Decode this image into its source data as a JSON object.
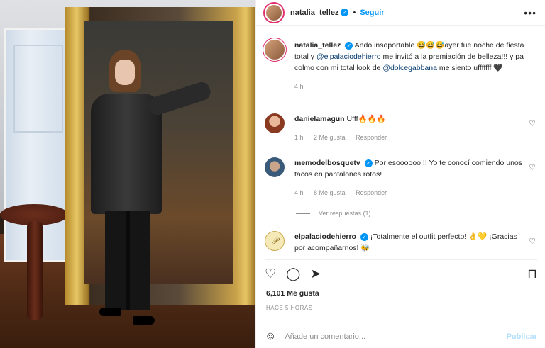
{
  "post": {
    "username": "natalia_tellez",
    "follow_label": "Seguir",
    "more_icon": "more-horizontal-icon",
    "caption": {
      "user": "natalia_tellez",
      "text_1": "Ando insoportable 😅😅😅ayer fue noche de fiesta total y ",
      "mention_1": "@elpalaciodehierro",
      "text_2": " me invitó a la premiación de belleza!!! y pa colmo con mi total look de ",
      "mention_2": "@dolcegabbana",
      "text_3": " me siento ufffffff 🖤",
      "time": "4 h"
    },
    "comments": [
      {
        "user": "danielamagun",
        "text": "Ufff🔥🔥🔥",
        "time": "1 h",
        "likes": "2 Me gusta",
        "reply": "Responder"
      },
      {
        "user": "memodelbosquetv",
        "text": "Por esoooooo!!! Yo te conocí comiendo unos tacos en pantalones rotos!",
        "time": "4 h",
        "likes": "8 Me gusta",
        "reply": "Responder",
        "view_replies": "Ver respuestas (1)"
      },
      {
        "user": "elpalaciodehierro",
        "text": "¡Totalmente el outfit perfecto! 👌💛 ¡Gracias por acompañarnos! 🐝"
      }
    ],
    "likes_count": "6,101 Me gusta",
    "posted_ago": "HACE 5 HORAS",
    "add_comment_placeholder": "Añade un comentario...",
    "publish_label": "Publicar"
  },
  "colors": {
    "accent": "#0095f6",
    "mention": "#00376b",
    "muted": "#8e8e8e",
    "publish_disabled": "#b2dffc"
  }
}
